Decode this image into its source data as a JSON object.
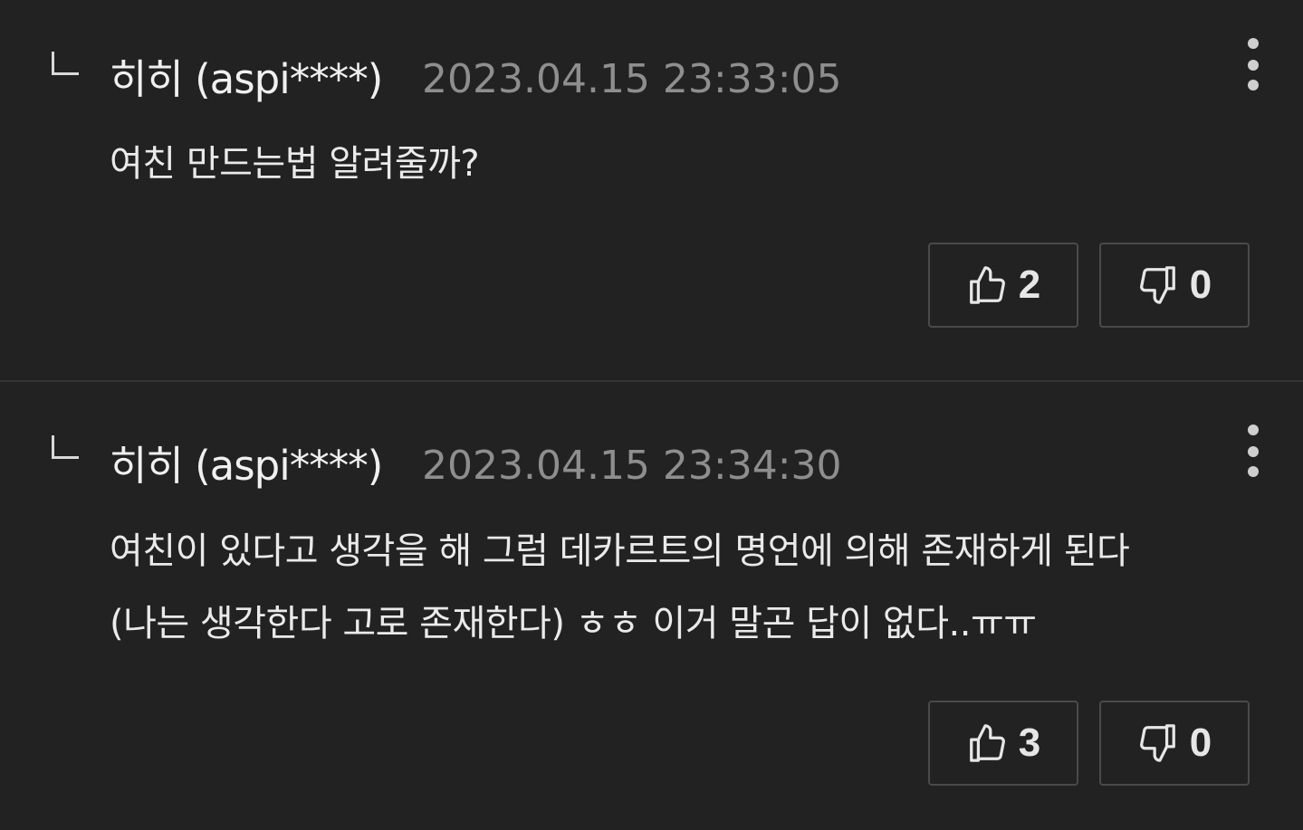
{
  "comments": [
    {
      "author": "히히 (aspi****)",
      "timestamp": "2023.04.15 23:33:05",
      "lines": [
        "여친 만드는법 알려줄까?"
      ],
      "likes": "2",
      "dislikes": "0"
    },
    {
      "author": "히히 (aspi****)",
      "timestamp": "2023.04.15 23:34:30",
      "lines": [
        "여친이 있다고 생각을 해 그럼 데카르트의 명언에 의해 존재하게 된다",
        "(나는 생각한다 고로 존재한다) ㅎㅎ 이거 말곤 답이 없다..ㅠㅠ"
      ],
      "likes": "3",
      "dislikes": "0"
    }
  ],
  "icons": {
    "reply": "reply-arrow-icon",
    "more": "more-vertical-icon",
    "like": "thumbs-up-icon",
    "dislike": "thumbs-down-icon"
  },
  "colors": {
    "background": "#222222",
    "text": "#eaeaea",
    "timestamp": "#8e8e8e",
    "border": "#4a4a4a"
  }
}
